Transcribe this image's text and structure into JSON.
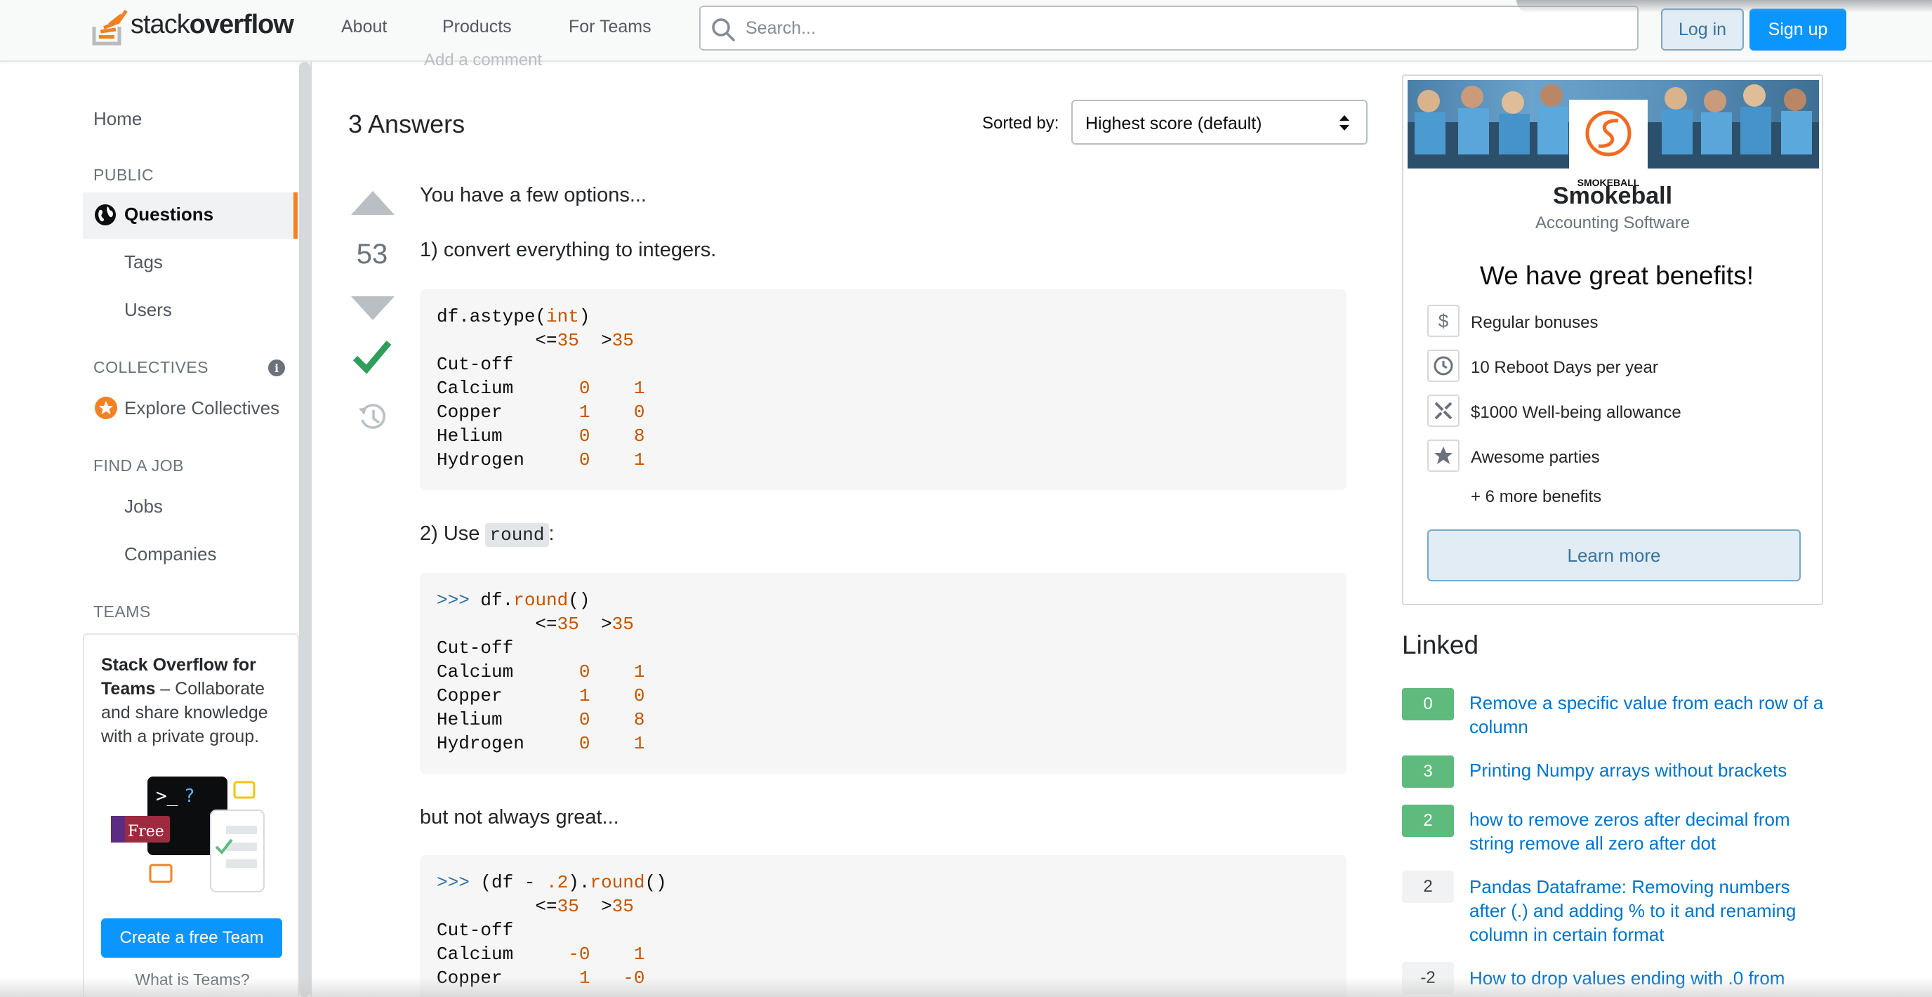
{
  "header": {
    "logo_text_plain": "stack",
    "logo_text_bold": "overflow",
    "nav": [
      "About",
      "Products",
      "For Teams"
    ],
    "search_placeholder": "Search...",
    "login": "Log in",
    "signup": "Sign up"
  },
  "sidebar": {
    "home": "Home",
    "public_heading": "PUBLIC",
    "questions": "Questions",
    "tags": "Tags",
    "users": "Users",
    "collectives_heading": "COLLECTIVES",
    "explore_collectives": "Explore Collectives",
    "job_heading": "FIND A JOB",
    "jobs": "Jobs",
    "companies": "Companies",
    "teams_heading": "TEAMS",
    "teams_title": "Stack Overflow for Teams",
    "teams_desc": " – Collaborate and share knowledge with a private group.",
    "free_badge": "Free",
    "create_team": "Create a free Team",
    "what_is_teams": "What is Teams?"
  },
  "main": {
    "add_comment": "Add a comment",
    "answers_heading": "3 Answers",
    "sorted_by_label": "Sorted by:",
    "sort_value": "Highest score (default)",
    "vote_count": "53",
    "p1": "You have a few options...",
    "p2": "1) convert everything to integers.",
    "code1_call_prefix": "df.astype(",
    "code1_call_kw": "int",
    "code1_call_suffix": ")",
    "p3_prefix": "2) Use ",
    "p3_code": "round",
    "p3_suffix": ":",
    "code2_prompt": ">>> ",
    "code2_call_prefix": "df.",
    "code2_call_kw": "round",
    "code2_call_suffix": "()",
    "p4": "but not always great...",
    "code3_prompt": ">>> ",
    "code3_call_a": "(df - ",
    "code3_call_kw1": ".2",
    "code3_call_b": ").",
    "code3_call_kw2": "round",
    "code3_call_c": "()",
    "table_cols": [
      "<=35",
      ">35"
    ],
    "table_index": "Cut-off",
    "table_rows": [
      {
        "name": "Calcium",
        "a": "0",
        "b": "1"
      },
      {
        "name": "Copper",
        "a": "1",
        "b": "0"
      },
      {
        "name": "Helium",
        "a": "0",
        "b": "8"
      },
      {
        "name": "Hydrogen",
        "a": "0",
        "b": "1"
      }
    ],
    "table3_rows": [
      {
        "name": "Calcium",
        "a": "-0",
        "b": "1"
      },
      {
        "name": "Copper",
        "a": "1",
        "b": "-0"
      }
    ]
  },
  "ad": {
    "logo_caption": "SMOKEBALL",
    "company": "Smokeball",
    "subtitle": "Accounting Software",
    "headline": "We have great benefits!",
    "benefits": [
      {
        "icon": "dollar-icon",
        "text": "Regular bonuses"
      },
      {
        "icon": "clock-icon",
        "text": "10 Reboot Days per year"
      },
      {
        "icon": "wellness-icon",
        "text": "$1000 Well-being allowance"
      },
      {
        "icon": "star-icon",
        "text": "Awesome parties"
      }
    ],
    "more": "+ 6 more benefits",
    "learn_more": "Learn more"
  },
  "linked": {
    "heading": "Linked",
    "items": [
      {
        "score": "0",
        "accepted": true,
        "title": "Remove a specific value from each row of a column"
      },
      {
        "score": "3",
        "accepted": true,
        "title": "Printing Numpy arrays without brackets"
      },
      {
        "score": "2",
        "accepted": true,
        "title": "how to remove zeros after decimal from string remove all zero after dot"
      },
      {
        "score": "2",
        "accepted": false,
        "title": "Pandas Dataframe: Removing numbers after (.) and adding % to it and renaming column in certain format"
      },
      {
        "score": "-2",
        "accepted": false,
        "title": "How to drop values ending with .0 from"
      }
    ]
  },
  "colors": {
    "accent_orange": "#f48225",
    "link_blue": "#0074cc",
    "button_blue": "#0a95ff",
    "accepted_green": "#5eba7d",
    "code_keyword": "#c45500"
  }
}
